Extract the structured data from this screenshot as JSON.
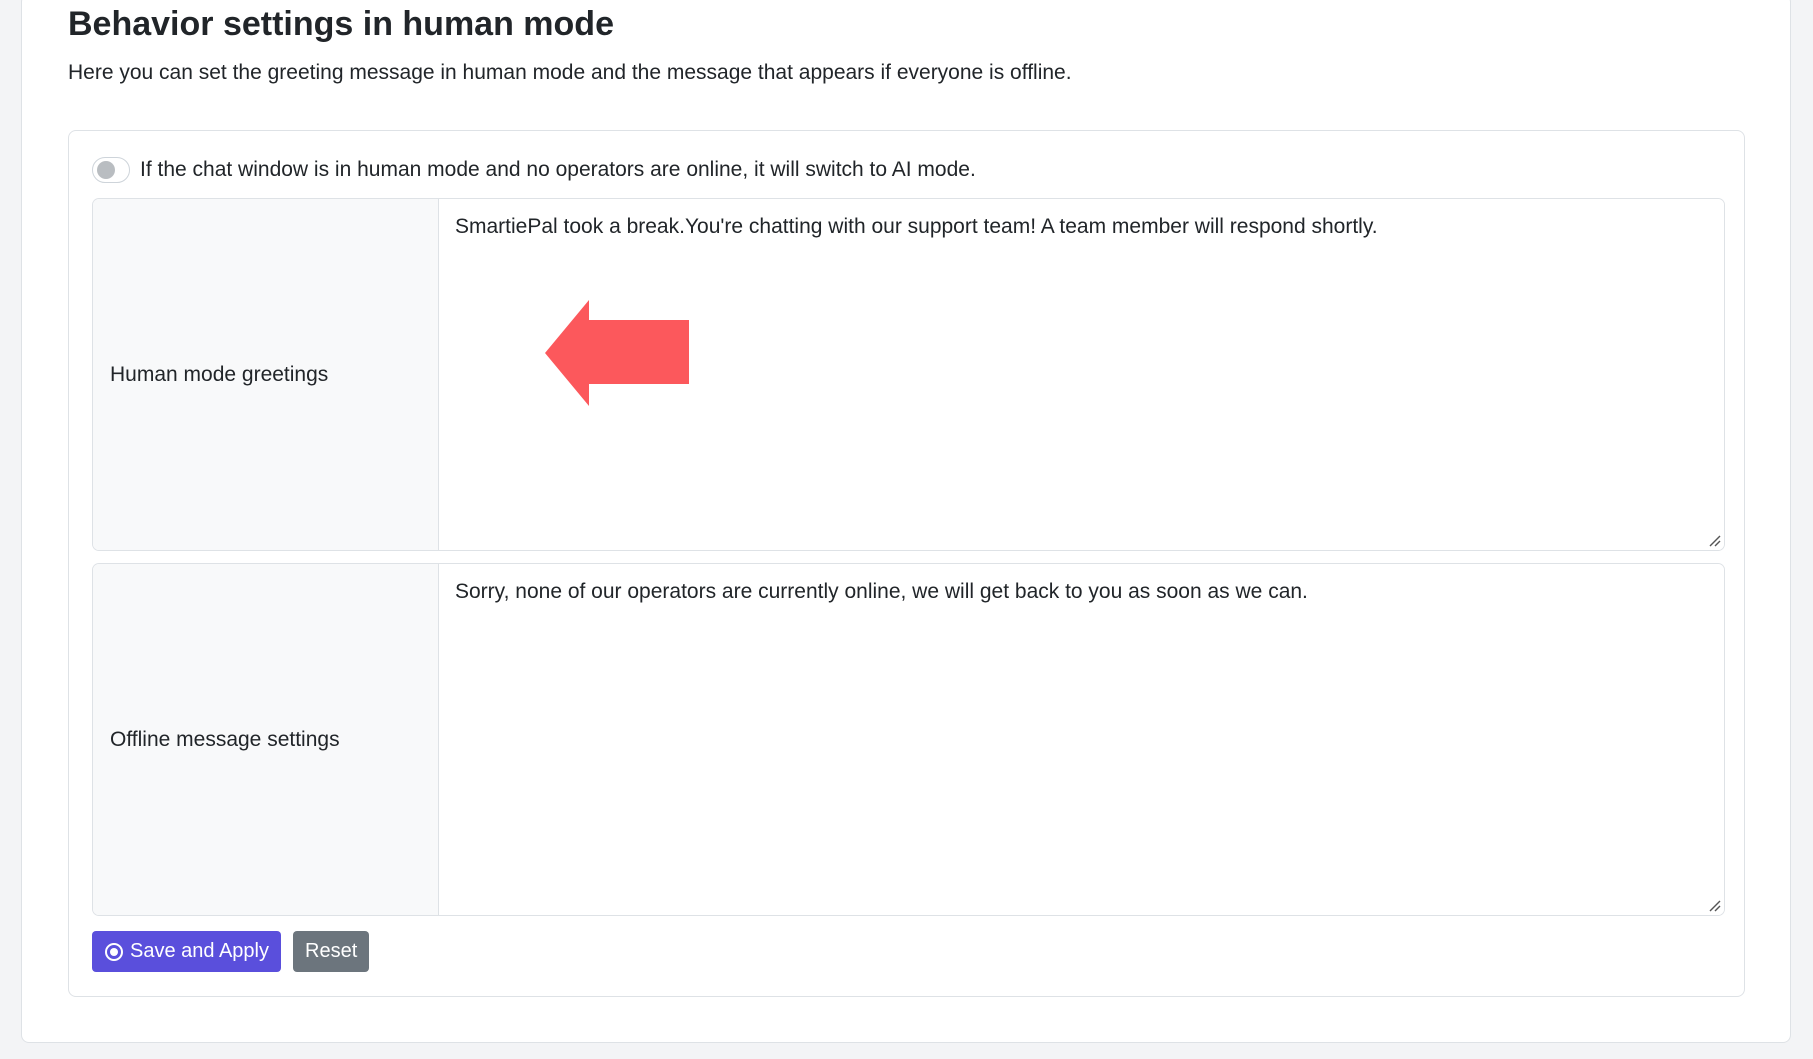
{
  "header": {
    "title": "Behavior settings in human mode",
    "subtitle": "Here you can set the greeting message in human mode and the message that appears if everyone is offline."
  },
  "settings": {
    "ai_fallback_toggle": {
      "label": "If the chat window is in human mode and no operators are online, it will switch to AI mode.",
      "enabled": false
    },
    "human_mode_greetings": {
      "label": "Human mode greetings",
      "value": "SmartiePal took a break.You're chatting with our support team! A team member will respond shortly."
    },
    "offline_message": {
      "label": "Offline message settings",
      "value": "Sorry, none of our operators are currently online, we will get back to you as soon as we can."
    }
  },
  "actions": {
    "save_label": "Save and Apply",
    "reset_label": "Reset"
  },
  "annotation": {
    "icon": "arrow-left-icon",
    "color": "#fc585c"
  },
  "colors": {
    "primary": "#5a4fdc",
    "secondary": "#6c757d"
  }
}
